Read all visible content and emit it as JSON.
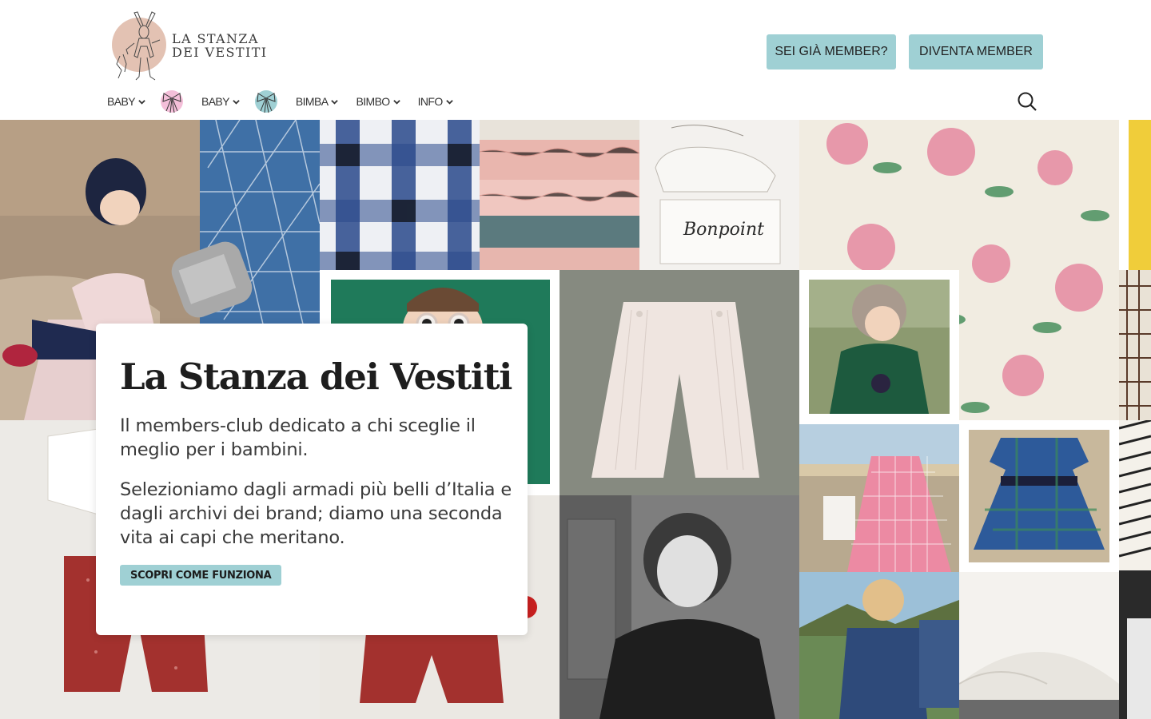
{
  "brand": {
    "line1": "LA STANZA",
    "line2": "DEI VESTITI",
    "logo_icon": "rabbit-logo-icon"
  },
  "header": {
    "login_label": "SEI GIÀ MEMBER?",
    "join_label": "DIVENTA MEMBER"
  },
  "nav": {
    "items": [
      {
        "label": "BABY",
        "bow": "pink-bow-icon"
      },
      {
        "label": "BABY",
        "bow": "blue-bow-icon"
      },
      {
        "label": "BIMBA"
      },
      {
        "label": "BIMBO"
      },
      {
        "label": "INFO"
      }
    ],
    "search_icon": "search-icon"
  },
  "hero": {
    "title": "La Stanza dei Vestiti",
    "paragraph1": "Il members-club dedicato a chi sceglie il meglio per i bambini.",
    "paragraph2": "Selezioniamo dagli armadi più belli d’Italia e dagli archivi dei brand; diamo una seconda vita ai capi che meritano.",
    "cta_label": "SCOPRI COME FUNZIONA",
    "shoebox_text": "Bonpoint"
  },
  "colors": {
    "accent": "#9fd0d4",
    "logo_circle": "#e3c2b3",
    "pink_bow": "#f4bfd9",
    "blue_bow": "#9fd0d4"
  }
}
